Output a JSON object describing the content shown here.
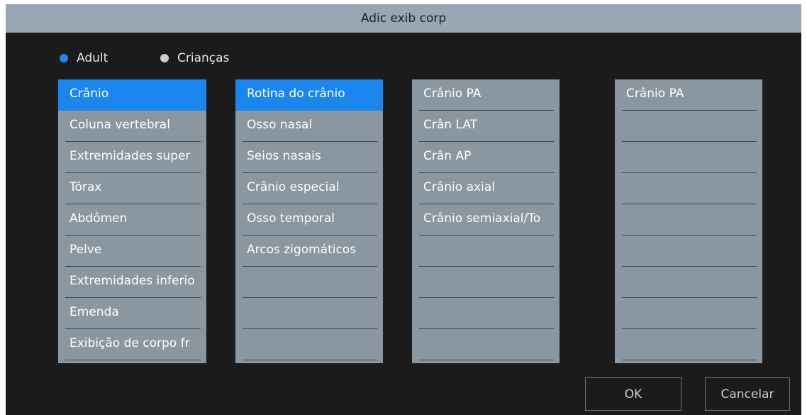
{
  "dialog": {
    "title": "Adic exib corp"
  },
  "radios": [
    {
      "label": "Adult",
      "selected": true
    },
    {
      "label": "Crianças",
      "selected": false
    }
  ],
  "lists": {
    "regions": {
      "items": [
        "Crânio",
        "Coluna vertebral",
        "Extremidades super",
        "Tórax",
        "Abdômen",
        "Pelve",
        "Extremidades inferio",
        "Emenda",
        "Exibição de corpo fr"
      ],
      "selected_index": 0
    },
    "protocols": {
      "items": [
        "Rotina do crânio",
        "Osso nasal",
        "Seios nasais",
        "Crânio especial",
        "Osso temporal",
        "Arcos zigomáticos",
        "",
        "",
        ""
      ],
      "selected_index": 0
    },
    "views": {
      "items": [
        "Crânio PA",
        "Crân LAT",
        "Crân AP",
        "Crânio axial",
        "Crânio semiaxial/To",
        "",
        "",
        "",
        ""
      ]
    },
    "added": {
      "items": [
        "Crânio PA",
        "",
        "",
        "",
        "",
        "",
        "",
        "",
        ""
      ]
    }
  },
  "buttons": {
    "ok": "OK",
    "cancel": "Cancelar"
  },
  "colors": {
    "accent": "#1b86ee",
    "titlebar": "#97a6b2",
    "list_bg": "#8a96a0",
    "dialog_bg": "#1b1b1b"
  }
}
